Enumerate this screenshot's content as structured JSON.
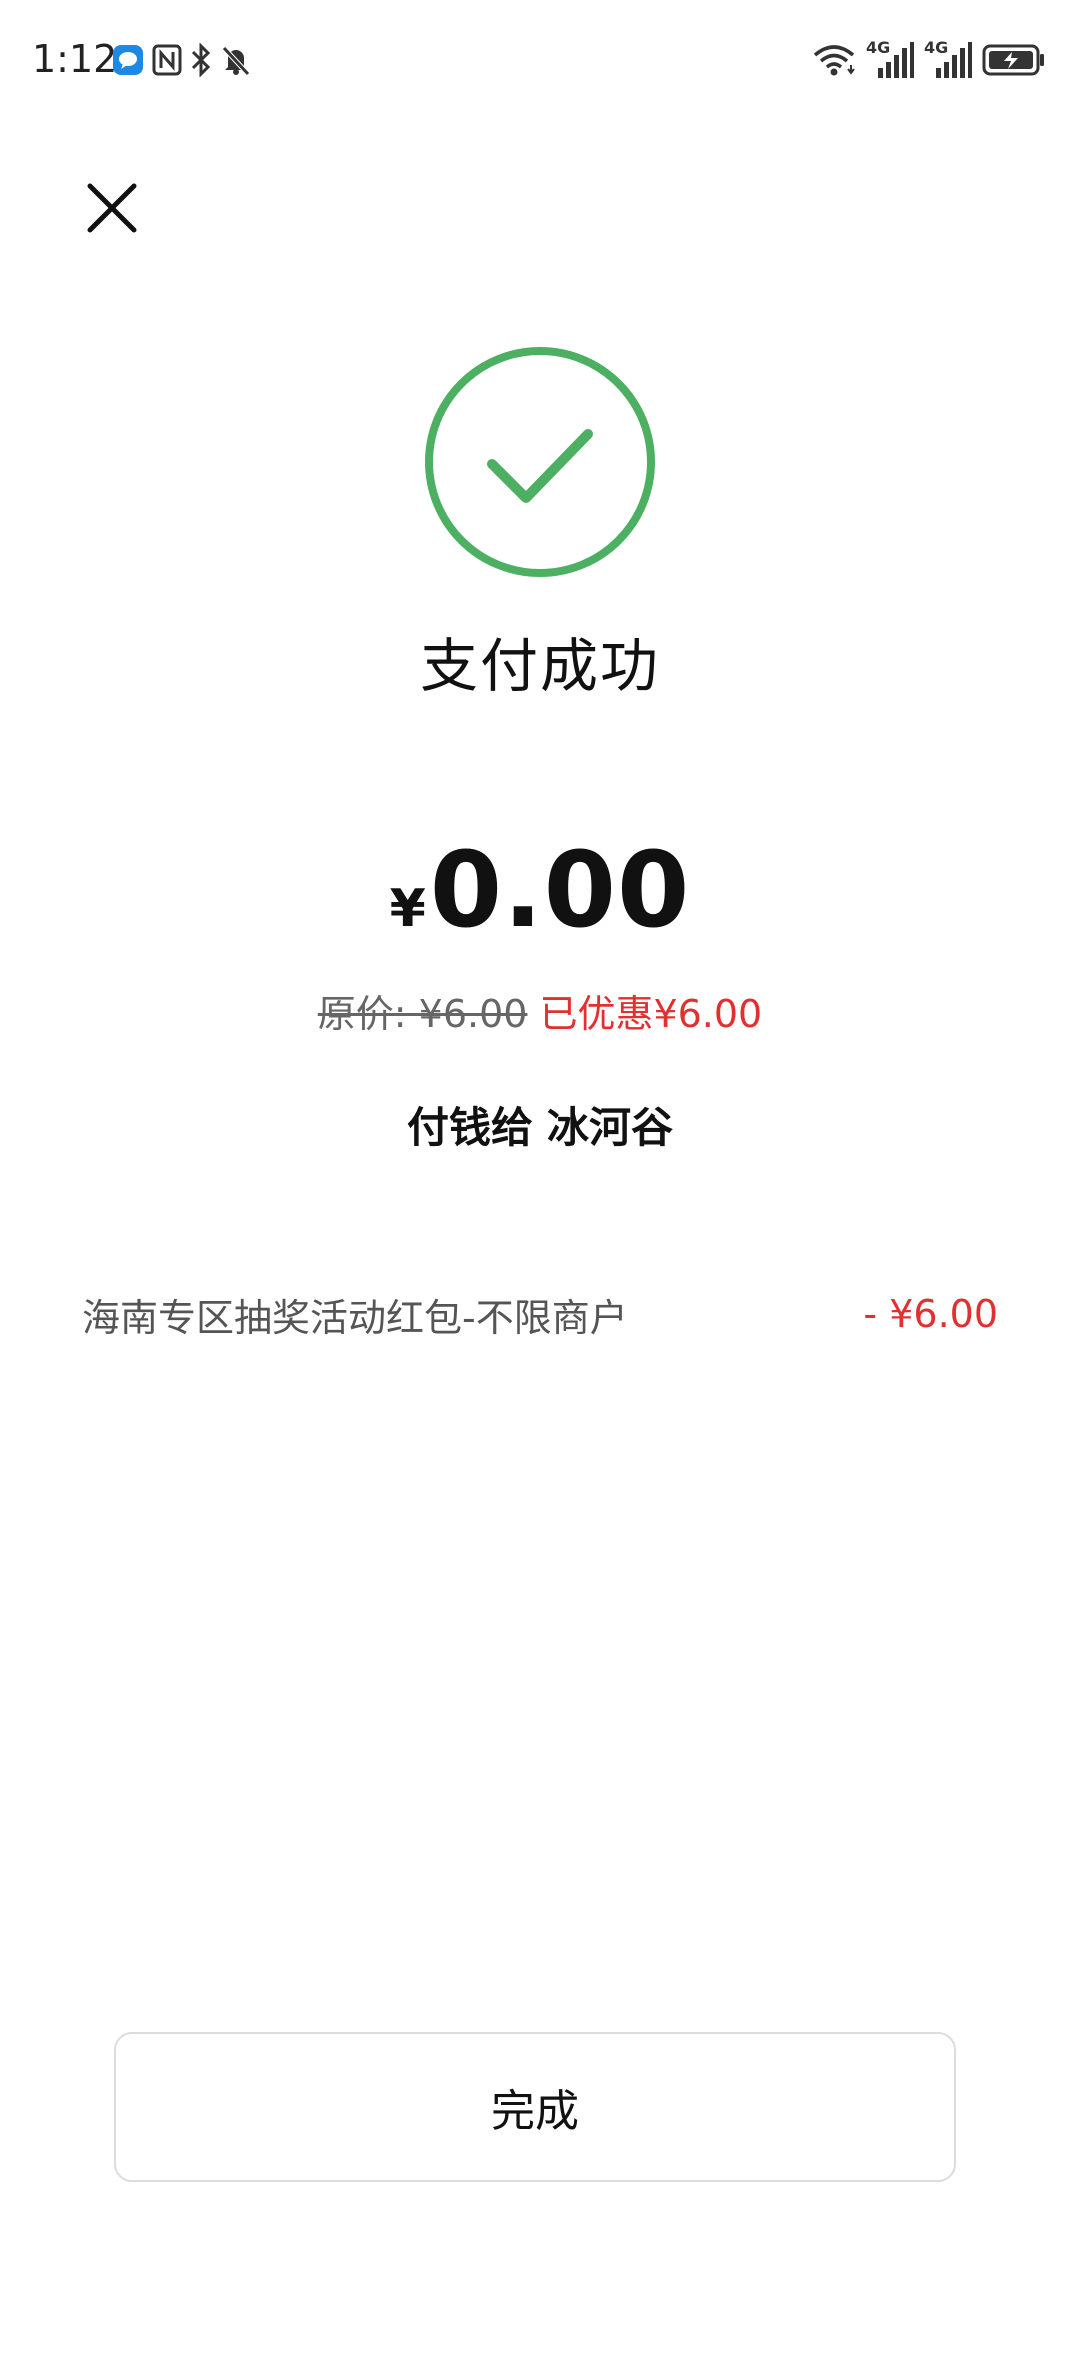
{
  "status_bar": {
    "time": "1:12",
    "left_icons": [
      "chat-bubble-icon",
      "nfc-icon",
      "bluetooth-icon",
      "mute-bell-icon"
    ],
    "right_icons": [
      "wifi-icon",
      "signal-4g-icon",
      "signal-4g-icon",
      "battery-charging-icon"
    ],
    "network_label_1": "4G",
    "network_label_2": "4G"
  },
  "header": {
    "close_icon": "close-icon"
  },
  "success": {
    "icon": "check-circle-icon",
    "title": "支付成功",
    "accent_color": "#4caf62"
  },
  "payment": {
    "currency": "¥",
    "amount": "0.00",
    "original_price": "原价: ¥6.00",
    "discount_text": "已优惠¥6.00",
    "payee_label": "付钱给",
    "payee_name": "冰河谷"
  },
  "coupon": {
    "name": "海南专区抽奖活动红包-不限商户",
    "amount": "- ¥6.00"
  },
  "footer": {
    "done_label": "完成"
  },
  "colors": {
    "discount_red": "#e0302f",
    "success_green": "#4caf62"
  }
}
